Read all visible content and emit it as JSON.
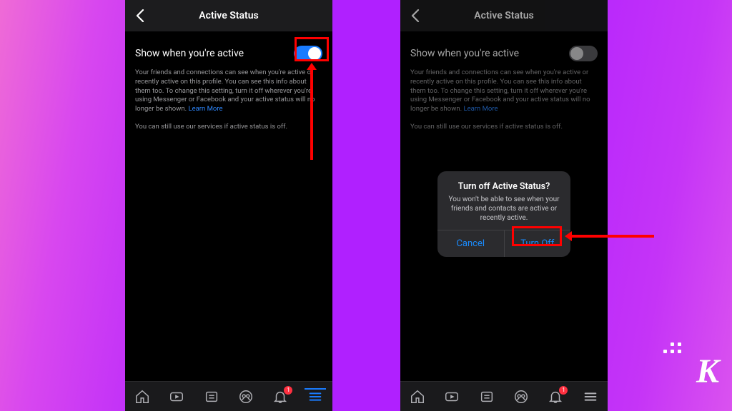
{
  "colors": {
    "accent": "#1a7cff",
    "danger": "#ff3040",
    "highlight": "#ff0000"
  },
  "screen1": {
    "header": {
      "title": "Active Status"
    },
    "setting": {
      "label": "Show when you're active",
      "toggle_on": true,
      "description": "Your friends and connections can see when you're active or recently active on this profile. You can see this info about them too. To change this setting, turn it off wherever you're using Messenger or Facebook and your active status will no longer be shown.",
      "learn_more": "Learn More",
      "footnote": "You can still use our services if active status is off."
    },
    "tabbar": {
      "notifications_badge": "1"
    }
  },
  "screen2": {
    "header": {
      "title": "Active Status"
    },
    "setting": {
      "label": "Show when you're active",
      "toggle_on": false,
      "description": "Your friends and connections can see when you're active or recently active on this profile. You can see this info about them too. To change this setting, turn it off wherever you're using Messenger or Facebook and your active status will no longer be shown.",
      "learn_more": "Learn More",
      "footnote": "You can still use our services if active status is off."
    },
    "dialog": {
      "title": "Turn off Active Status?",
      "message": "You won't be able to see when your friends and contacts are active or recently active.",
      "cancel": "Cancel",
      "confirm": "Turn Off"
    },
    "tabbar": {
      "notifications_badge": "1"
    }
  },
  "logo": {
    "letter": "K"
  }
}
